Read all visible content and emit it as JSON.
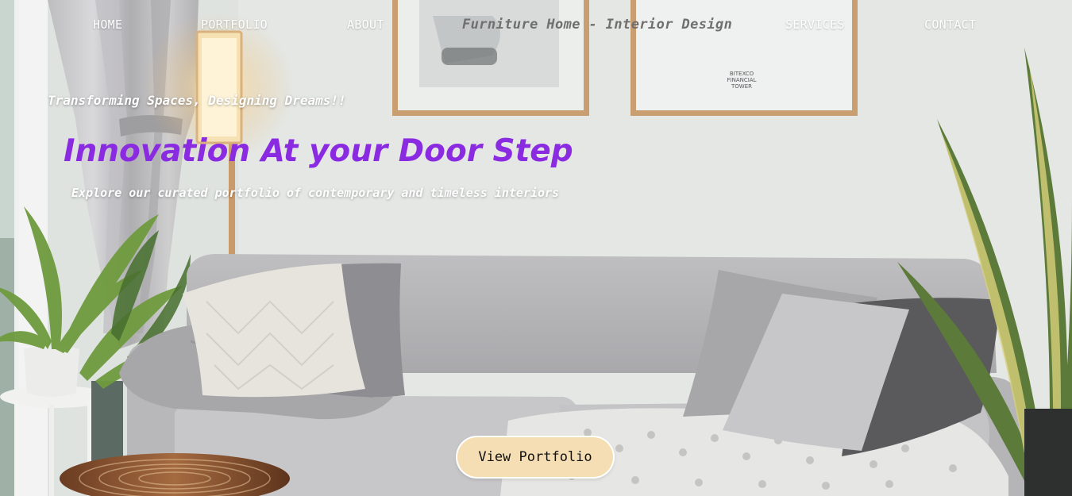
{
  "nav": {
    "home": "HOME",
    "portfolio": "PORTFOLIO",
    "about": "ABOUT",
    "brand": "Furniture Home - Interior Design",
    "services": "SERVICES",
    "contact": "CONTACT"
  },
  "hero": {
    "tagline": "Transforming Spaces, Designing Dreams!!",
    "headline": "Innovation At your Door Step",
    "subline": "Explore our curated portfolio of contemporary and timeless interiors",
    "cta_label": "View Portfolio"
  },
  "artwork": {
    "poster_text": [
      "BITEXCO",
      "FINANCIAL",
      "TOWER"
    ]
  },
  "colors": {
    "headline": "#8a2be2",
    "cta_background": "#f5deb3",
    "nav_text": "#ffffff",
    "brand_text": "#6f6f6f"
  }
}
